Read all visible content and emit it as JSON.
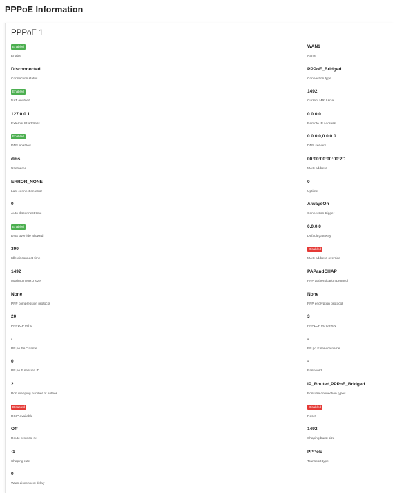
{
  "page": {
    "title": "PPPoE Information"
  },
  "section": {
    "title": "PPPoE 1"
  },
  "colors": {
    "enabled": "#4caf50",
    "disabled": "#e53935"
  },
  "left_fields": [
    {
      "value": "Enabled",
      "label": "Enable",
      "badge": "enabled"
    },
    {
      "value": "Disconnected",
      "label": "Connection status"
    },
    {
      "value": "Enabled",
      "label": "NAT enabled",
      "badge": "enabled"
    },
    {
      "value": "127.0.0.1",
      "label": "External IP address"
    },
    {
      "value": "Enabled",
      "label": "DNS enabled",
      "badge": "enabled"
    },
    {
      "value": "dms",
      "label": "Username"
    },
    {
      "value": "ERROR_NONE",
      "label": "Last connection error"
    },
    {
      "value": "0",
      "label": "Auto disconnect time"
    },
    {
      "value": "Enabled",
      "label": "DNS override allowed",
      "badge": "enabled"
    },
    {
      "value": "300",
      "label": "Idle disconnect time"
    },
    {
      "value": "1492",
      "label": "Maximum MRU size"
    },
    {
      "value": "None",
      "label": "PPP compression protocol"
    },
    {
      "value": "20",
      "label": "PPPLCP echo"
    },
    {
      "value": "-",
      "label": "PP po EAC name"
    },
    {
      "value": "0",
      "label": "PP po E session ID"
    },
    {
      "value": "2",
      "label": "Port mapping number of entries"
    },
    {
      "value": "Disabled",
      "label": "RSIP available",
      "badge": "disabled"
    },
    {
      "value": "Off",
      "label": "Route protocol rx"
    },
    {
      "value": "-1",
      "label": "Shaping rate"
    },
    {
      "value": "0",
      "label": "Warn disconnect delay"
    }
  ],
  "right_fields": [
    {
      "value": "WAN1",
      "label": "Name"
    },
    {
      "value": "PPPoE_Bridged",
      "label": "Connection type"
    },
    {
      "value": "1492",
      "label": "Current MRU size"
    },
    {
      "value": "0.0.0.0",
      "label": "Remote IP address"
    },
    {
      "value": "0.0.0.0,0.0.0.0",
      "label": "DNS servers"
    },
    {
      "value": "00:00:00:00:00:2D",
      "label": "MAC address"
    },
    {
      "value": "0",
      "label": "Uptime"
    },
    {
      "value": "AlwaysOn",
      "label": "Connection trigger"
    },
    {
      "value": "0.0.0.0",
      "label": "Default gateway"
    },
    {
      "value": "Disabled",
      "label": "MAC address override",
      "badge": "disabled"
    },
    {
      "value": "PAPandCHAP",
      "label": "PPP authentication protocol"
    },
    {
      "value": "None",
      "label": "PPP encryption protocol"
    },
    {
      "value": "3",
      "label": "PPPLCP echo retry"
    },
    {
      "value": "-",
      "label": "PP po E service name"
    },
    {
      "value": "-",
      "label": "Password"
    },
    {
      "value": "IP_Routed,PPPoE_Bridged",
      "label": "Possible connection types"
    },
    {
      "value": "Disabled",
      "label": "Reset",
      "badge": "disabled"
    },
    {
      "value": "1492",
      "label": "Shaping burst size"
    },
    {
      "value": "PPPoE",
      "label": "Transport type"
    }
  ]
}
